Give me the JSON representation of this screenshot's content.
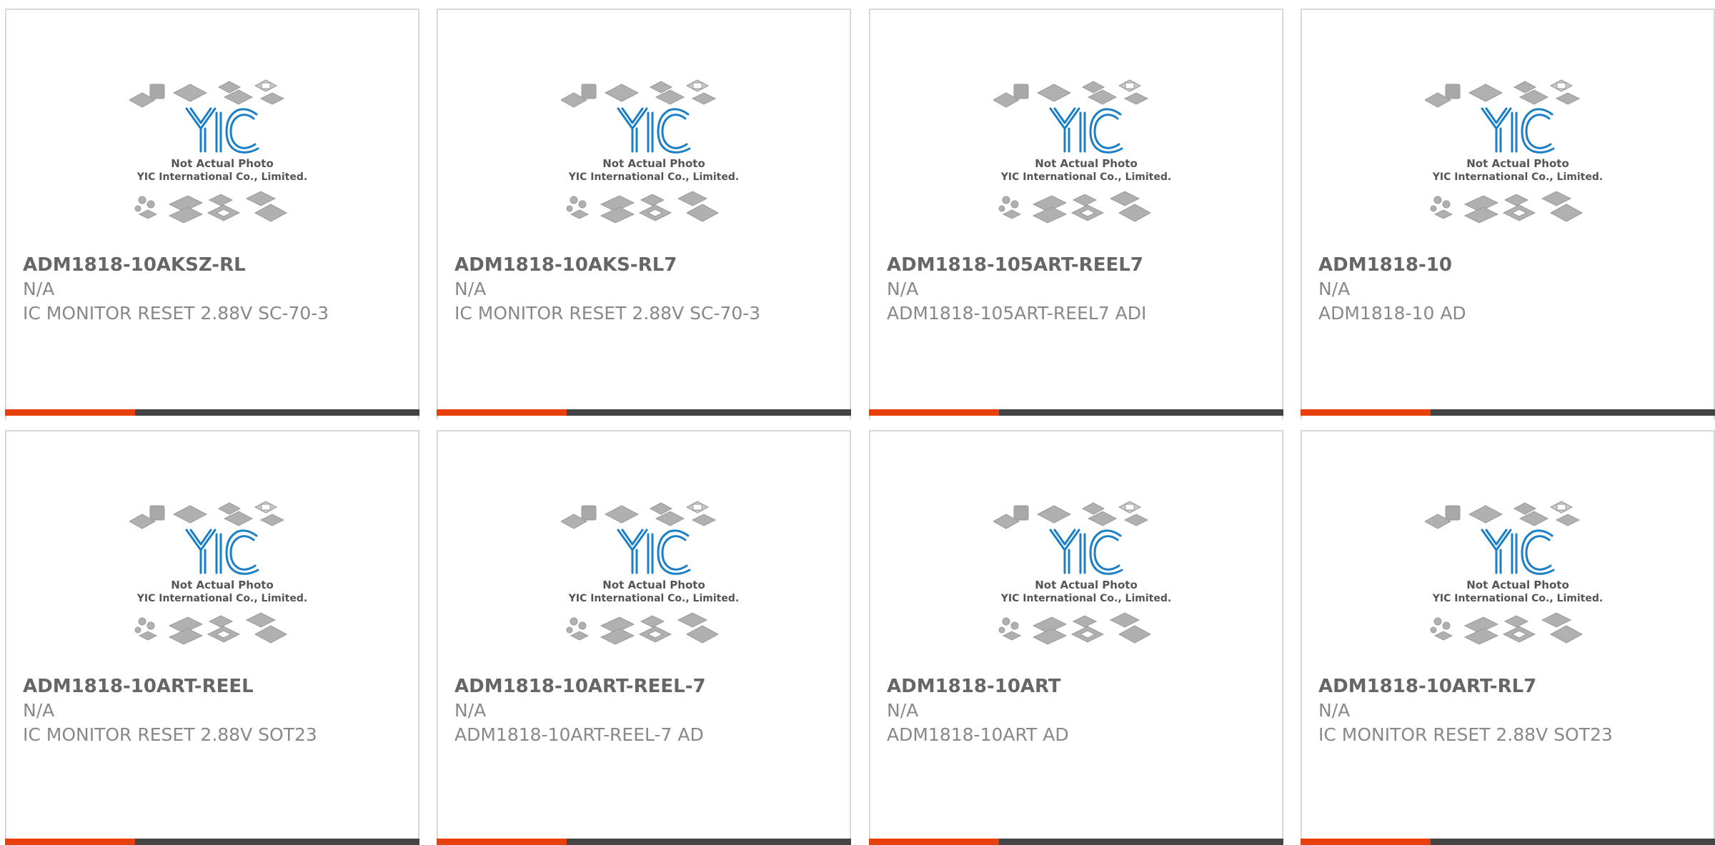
{
  "colors": {
    "accent": "#e8400c",
    "bar_dark": "#444444",
    "logo_blue": "#1a7fc7"
  },
  "placeholder_image": {
    "line1": "Not Actual Photo",
    "line2": "YIC International Co., Limited.",
    "logo_text": "YIC"
  },
  "products": [
    {
      "part": "ADM1818-10AKSZ-RL",
      "mfr": "N/A",
      "desc": "IC MONITOR RESET 2.88V SC-70-3"
    },
    {
      "part": "ADM1818-10AKS-RL7",
      "mfr": "N/A",
      "desc": "IC MONITOR RESET 2.88V SC-70-3"
    },
    {
      "part": "ADM1818-105ART-REEL7",
      "mfr": "N/A",
      "desc": "ADM1818-105ART-REEL7 ADI"
    },
    {
      "part": "ADM1818-10",
      "mfr": "N/A",
      "desc": "ADM1818-10 AD"
    },
    {
      "part": "ADM1818-10ART-REEL",
      "mfr": "N/A",
      "desc": "IC MONITOR RESET 2.88V SOT23"
    },
    {
      "part": "ADM1818-10ART-REEL-7",
      "mfr": "N/A",
      "desc": "ADM1818-10ART-REEL-7 AD"
    },
    {
      "part": "ADM1818-10ART",
      "mfr": "N/A",
      "desc": "ADM1818-10ART AD"
    },
    {
      "part": "ADM1818-10ART-RL7",
      "mfr": "N/A",
      "desc": "IC MONITOR RESET 2.88V SOT23"
    }
  ]
}
